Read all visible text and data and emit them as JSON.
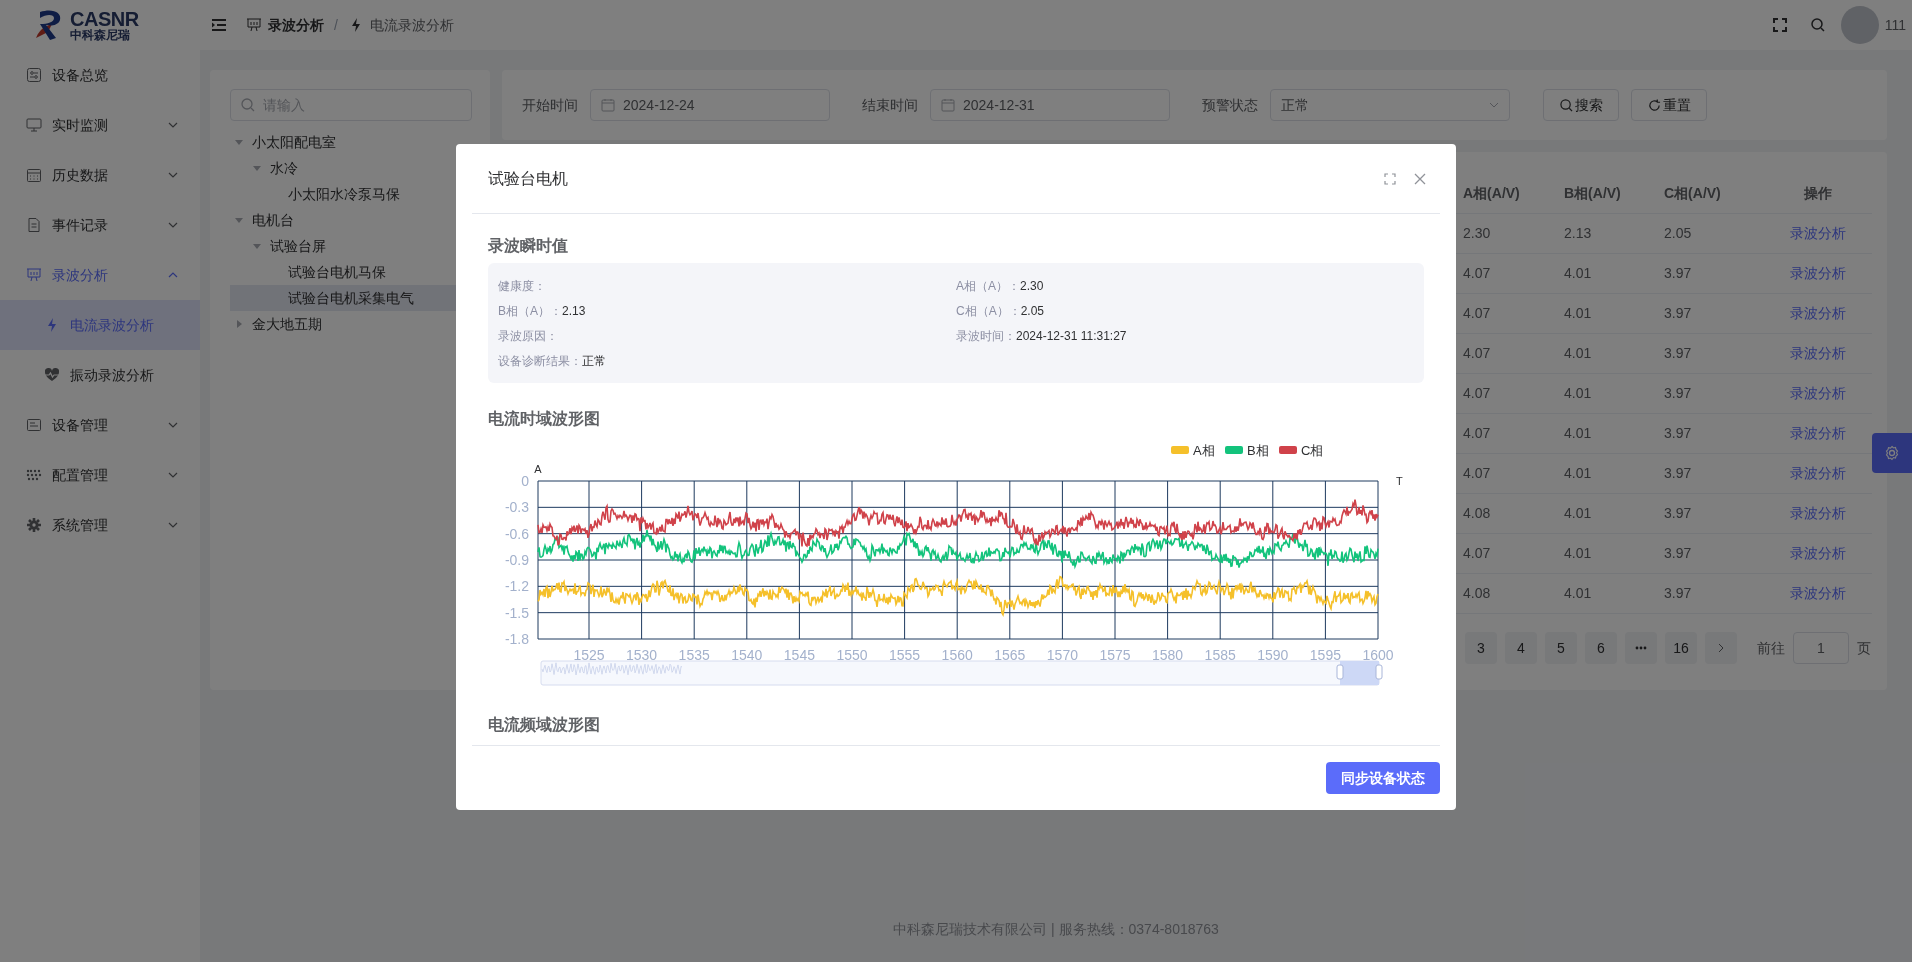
{
  "logo": {
    "name": "CASNR",
    "subtitle": "中科森尼瑞"
  },
  "header": {
    "breadcrumb": [
      {
        "label": "录波分析",
        "current": false
      },
      {
        "label": "电流录波分析",
        "current": true
      }
    ],
    "separator": "/",
    "user": "111"
  },
  "sidebar": {
    "items": [
      {
        "label": "设备总览",
        "kind": "link",
        "selected": false
      },
      {
        "label": "实时监测",
        "kind": "group",
        "expanded": false,
        "selected": false
      },
      {
        "label": "历史数据",
        "kind": "group",
        "expanded": false,
        "selected": false
      },
      {
        "label": "事件记录",
        "kind": "group",
        "expanded": false,
        "selected": false
      },
      {
        "label": "录波分析",
        "kind": "group",
        "expanded": true,
        "selected": true,
        "children": [
          {
            "label": "电流录波分析",
            "selected": true
          },
          {
            "label": "振动录波分析",
            "selected": false
          }
        ]
      },
      {
        "label": "设备管理",
        "kind": "group",
        "expanded": false,
        "selected": false
      },
      {
        "label": "配置管理",
        "kind": "group",
        "expanded": false,
        "selected": false
      },
      {
        "label": "系统管理",
        "kind": "group",
        "expanded": false,
        "selected": false
      }
    ]
  },
  "tree": {
    "search": {
      "placeholder": "请输入"
    },
    "nodes": [
      {
        "label": "小太阳配电室",
        "expanded": true,
        "selected": false,
        "children": [
          {
            "label": "水冷",
            "expanded": true,
            "selected": false,
            "children": [
              {
                "label": "小太阳水冷泵马保",
                "selected": false
              }
            ]
          }
        ]
      },
      {
        "label": "电机台",
        "expanded": true,
        "selected": false,
        "children": [
          {
            "label": "试验台屏",
            "expanded": true,
            "selected": false,
            "children": [
              {
                "label": "试验台电机马保",
                "selected": false
              },
              {
                "label": "试验台电机采集电气",
                "selected": true
              }
            ]
          }
        ]
      },
      {
        "label": "金大地五期",
        "expanded": false,
        "selected": false
      }
    ]
  },
  "filters": [
    {
      "label": "开始时间",
      "kind": "date",
      "value": "2024-12-24"
    },
    {
      "label": "结束时间",
      "kind": "date",
      "value": "2024-12-31"
    },
    {
      "label": "预警状态",
      "kind": "select",
      "value": "正常"
    }
  ],
  "filter_buttons": [
    {
      "label": "搜索",
      "kind": "search"
    },
    {
      "label": "重置",
      "kind": "reset"
    }
  ],
  "table": {
    "columns": [
      "A相(A/V)",
      "B相(A/V)",
      "C相(A/V)",
      "操作"
    ],
    "rows": [
      [
        "2.30",
        "2.13",
        "2.05",
        "录波分析"
      ],
      [
        "4.07",
        "4.01",
        "3.97",
        "录波分析"
      ],
      [
        "4.07",
        "4.01",
        "3.97",
        "录波分析"
      ],
      [
        "4.07",
        "4.01",
        "3.97",
        "录波分析"
      ],
      [
        "4.07",
        "4.01",
        "3.97",
        "录波分析"
      ],
      [
        "4.07",
        "4.01",
        "3.97",
        "录波分析"
      ],
      [
        "4.07",
        "4.01",
        "3.97",
        "录波分析"
      ],
      [
        "4.08",
        "4.01",
        "3.97",
        "录波分析"
      ],
      [
        "4.07",
        "4.01",
        "3.97",
        "录波分析"
      ],
      [
        "4.08",
        "4.01",
        "3.97",
        "录波分析"
      ]
    ]
  },
  "pagination": {
    "pages": [
      {
        "kind": "page",
        "label": "3",
        "selected": false
      },
      {
        "kind": "page",
        "label": "4",
        "selected": false
      },
      {
        "kind": "page",
        "label": "5",
        "selected": false
      },
      {
        "kind": "page",
        "label": "6",
        "selected": false
      },
      {
        "kind": "more",
        "selected": false
      },
      {
        "kind": "page",
        "label": "16",
        "selected": false
      },
      {
        "kind": "next",
        "selected": false
      }
    ],
    "goto_label": "前往",
    "goto_value": "1",
    "goto_suffix": "页"
  },
  "modal": {
    "title": "试验台电机",
    "info_title": "录波瞬时值",
    "fields": [
      {
        "label": "健康度："
      },
      {
        "label": "A相（A）：",
        "value": "2.30"
      },
      {
        "label": "B相（A）：",
        "value": "2.13"
      },
      {
        "label": "C相（A）：",
        "value": "2.05"
      },
      {
        "label": "录波原因："
      },
      {
        "label": "录波时间：",
        "value": "2024-12-31 11:31:27"
      },
      {
        "label": "设备诊断结果：",
        "value": "正常"
      }
    ],
    "time_chart_title": "电流时域波形图",
    "waveform": {
      "y_axis_name": "A",
      "x_axis_name": "T",
      "yticks": [
        "0",
        "-0.3",
        "-0.6",
        "-0.9",
        "-1.2",
        "-1.5",
        "-1.8"
      ],
      "xticks": [
        "1525",
        "1530",
        "1535",
        "1540",
        "1545",
        "1550",
        "1555",
        "1560",
        "1565",
        "1570",
        "1575",
        "1580",
        "1585",
        "1590",
        "1595",
        "1600"
      ],
      "legend": [
        {
          "name": "A相",
          "color": "#f5c02a"
        },
        {
          "name": "B相",
          "color": "#13c37c"
        },
        {
          "name": "C相",
          "color": "#d0424a"
        }
      ]
    },
    "freq_chart_title": "电流频域波形图",
    "button": "同步设备状态"
  },
  "footer": "中科森尼瑞技术有限公司 | 服务热线：0374-8018763"
}
